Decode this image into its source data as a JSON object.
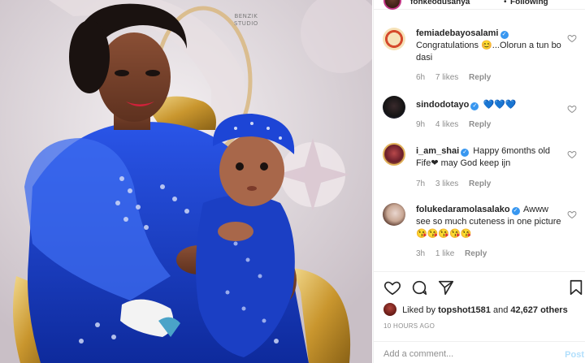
{
  "photo": {
    "watermark_line1": "BENZIK",
    "watermark_line2": "STUDIO"
  },
  "header": {
    "username": "fonkeodusanya",
    "separator": "•",
    "follow_status": "Following"
  },
  "comments": [
    {
      "username": "femiadebayosalami",
      "verified": true,
      "text": "Congratulations 😊...Olorun a tun bo dasi",
      "time": "6h",
      "likes": "7 likes",
      "reply": "Reply"
    },
    {
      "username": "sindodotayo",
      "verified": true,
      "text": "💙💙💙",
      "time": "9h",
      "likes": "4 likes",
      "reply": "Reply"
    },
    {
      "username": "i_am_shai",
      "verified": true,
      "text": "Happy 6months old Fife❤ may God keep ijn",
      "time": "7h",
      "likes": "3 likes",
      "reply": "Reply"
    },
    {
      "username": "folukedaramolasalako",
      "verified": true,
      "text": "Awww see so much cuteness in one picture 😘😘😘😘😘",
      "time": "3h",
      "likes": "1 like",
      "reply": "Reply"
    }
  ],
  "likes_row": {
    "prefix": "Liked by",
    "user": "topshot1581",
    "connector": "and",
    "others": "42,627 others"
  },
  "time_ago": "10 HOURS AGO",
  "add_comment": {
    "placeholder": "Add a comment...",
    "post_label": "Post"
  },
  "colors": {
    "verified": "#3897f0",
    "meta_text": "#8e8e8e",
    "post_disabled": "#b2dffc"
  },
  "icons": [
    "heart-icon",
    "comment-icon",
    "share-icon",
    "bookmark-icon"
  ]
}
